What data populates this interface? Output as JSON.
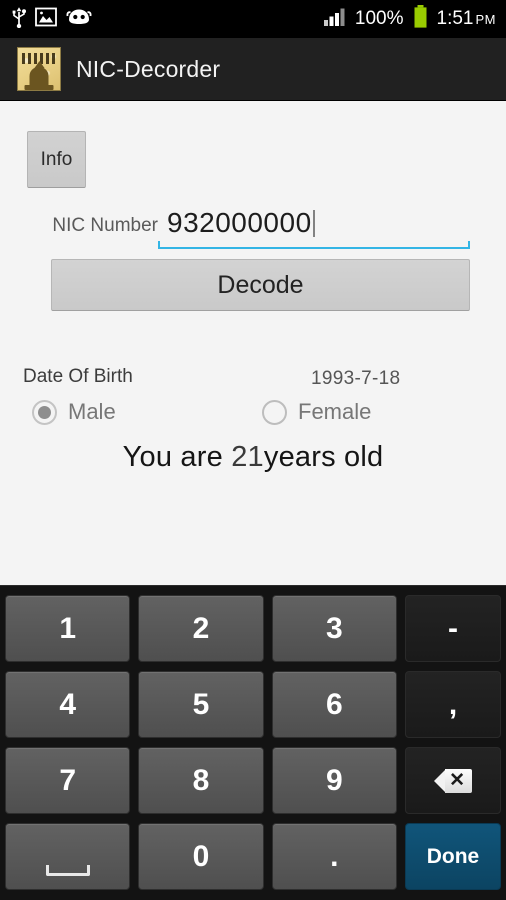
{
  "statusbar": {
    "icons_left": [
      "usb-icon",
      "gallery-image-icon",
      "cyanogenmod-android-icon"
    ],
    "signal_icon": "signal-bars-icon",
    "battery_percent": "100%",
    "battery_icon": "battery-full-icon",
    "clock_time": "1:51",
    "clock_ampm": "PM"
  },
  "actionbar": {
    "app_icon": "nic-decorder-app-icon",
    "title": "NIC-Decorder"
  },
  "content": {
    "info_button": "Info",
    "nic_label": "NIC Number",
    "nic_value": "932000000",
    "nic_placeholder": "NIC Number",
    "decode_button": "Decode",
    "dob_label": "Date Of Birth",
    "dob_value": "1993-7-18",
    "gender": {
      "male_label": "Male",
      "female_label": "Female",
      "selected": "Male"
    },
    "age_prefix": "You are ",
    "age_number": "21",
    "age_suffix": "years old"
  },
  "keyboard": {
    "rows": [
      [
        {
          "label": "1",
          "type": "num",
          "name": "key-1"
        },
        {
          "label": "2",
          "type": "num",
          "name": "key-2"
        },
        {
          "label": "3",
          "type": "num",
          "name": "key-3"
        },
        {
          "label": "-",
          "type": "fn",
          "name": "key-minus"
        }
      ],
      [
        {
          "label": "4",
          "type": "num",
          "name": "key-4"
        },
        {
          "label": "5",
          "type": "num",
          "name": "key-5"
        },
        {
          "label": "6",
          "type": "num",
          "name": "key-6"
        },
        {
          "label": ",",
          "type": "fn",
          "name": "key-comma"
        }
      ],
      [
        {
          "label": "7",
          "type": "num",
          "name": "key-7"
        },
        {
          "label": "8",
          "type": "num",
          "name": "key-8"
        },
        {
          "label": "9",
          "type": "num",
          "name": "key-9"
        },
        {
          "label": "",
          "type": "fn",
          "name": "key-backspace",
          "icon": "backspace-icon"
        }
      ],
      [
        {
          "label": "",
          "type": "num",
          "name": "key-space",
          "icon": "spacebar-icon"
        },
        {
          "label": "0",
          "type": "num",
          "name": "key-0"
        },
        {
          "label": ".",
          "type": "num",
          "name": "key-period"
        },
        {
          "label": "Done",
          "type": "done",
          "name": "key-done"
        }
      ]
    ]
  },
  "colors": {
    "statusbar_bg": "#000000",
    "actionbar_bg": "#212121",
    "content_bg": "#f4f4f4",
    "accent_underline": "#33b5e5",
    "button_bg": "#cdcdcd",
    "keyboard_bg": "#131313",
    "key_bg": "#575757",
    "done_key_bg": "#0c4462",
    "battery_green": "#99cc00",
    "app_icon_bg": "#e8cf84"
  }
}
